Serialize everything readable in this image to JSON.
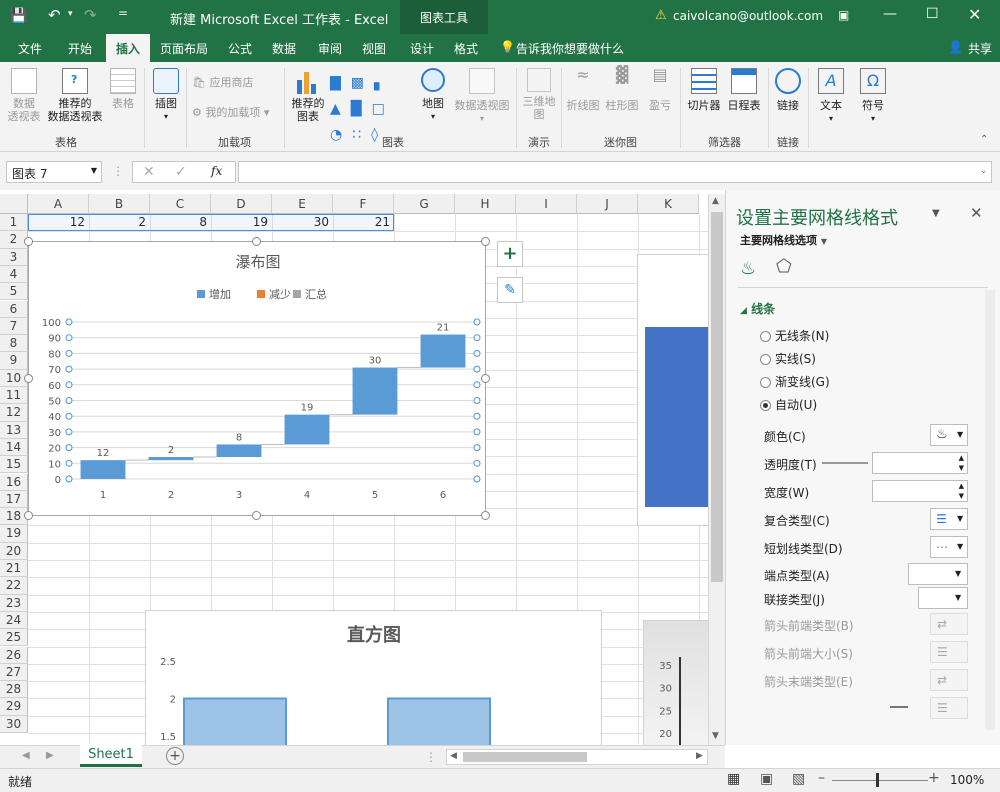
{
  "window": {
    "title": "新建 Microsoft Excel 工作表 - Excel",
    "context_tool": "图表工具",
    "account": "caivolcano@outlook.com",
    "share": "共享",
    "tell_me": "告诉我你想要做什么"
  },
  "tabs": [
    "文件",
    "开始",
    "插入",
    "页面布局",
    "公式",
    "数据",
    "审阅",
    "视图",
    "设计",
    "格式"
  ],
  "ribbon": {
    "buttons": {
      "pivot": "数据\n透视表",
      "rec_pivot": "推荐的\n数据透视表",
      "table": "表格",
      "illustrations": "插图",
      "store": "应用商店",
      "my_addins": "我的加载项",
      "rec_charts": "推荐的\n图表",
      "map": "地图",
      "pivot_chart": "数据透视图",
      "map3d": "三维地\n图",
      "line": "折线图",
      "column": "柱形图",
      "winloss": "盈亏",
      "slicer": "切片器",
      "timeline": "日程表",
      "link": "链接",
      "text": "文本",
      "symbol": "符号"
    },
    "groups": [
      "表格",
      "加载项",
      "图表",
      "演示",
      "迷你图",
      "筛选器",
      "链接"
    ]
  },
  "formula_bar": {
    "name_box": "图表 7",
    "fx": "fx",
    "content": ""
  },
  "sheet": {
    "columns": [
      "A",
      "B",
      "C",
      "D",
      "E",
      "F",
      "G",
      "H",
      "I",
      "J",
      "K"
    ],
    "rows": [
      "1",
      "2",
      "3",
      "4",
      "5",
      "6",
      "7",
      "8",
      "9",
      "10",
      "11",
      "12",
      "13",
      "14",
      "15",
      "16",
      "17",
      "18",
      "19",
      "20",
      "21",
      "22",
      "23",
      "24",
      "25",
      "26",
      "27",
      "28",
      "29",
      "30"
    ],
    "row1_values": [
      "12",
      "2",
      "8",
      "19",
      "30",
      "21"
    ],
    "tab": "Sheet1"
  },
  "chart_data": [
    {
      "type": "bar",
      "subtype": "waterfall",
      "title": "瀑布图",
      "legend": [
        "增加",
        "减少",
        "汇总"
      ],
      "legend_colors": [
        "#5b9bd5",
        "#ed7d31",
        "#a5a5a5"
      ],
      "legend_position": "top",
      "categories": [
        "1",
        "2",
        "3",
        "4",
        "5",
        "6"
      ],
      "values": [
        12,
        2,
        8,
        19,
        30,
        21
      ],
      "ylim": [
        0,
        100
      ],
      "yticks": [
        "0",
        "10",
        "20",
        "30",
        "40",
        "50",
        "60",
        "70",
        "80",
        "90",
        "100"
      ],
      "grid": true,
      "color": "#5b9bd5"
    },
    {
      "type": "bar",
      "subtype": "histogram",
      "title": "直方图",
      "yticks": [
        "1.5",
        "2",
        "2.5"
      ],
      "values": [
        2,
        2
      ],
      "grid": false,
      "color": "#9dc3e6"
    },
    {
      "type": "bar",
      "partially_visible": true,
      "yticks": [
        "20",
        "25",
        "30",
        "35"
      ]
    }
  ],
  "panel": {
    "title": "设置主要网格线格式",
    "subtitle": "主要网格线选项",
    "section": "线条",
    "radios": [
      {
        "label": "无线条(N)",
        "checked": false
      },
      {
        "label": "实线(S)",
        "checked": false
      },
      {
        "label": "渐变线(G)",
        "checked": false
      },
      {
        "label": "自动(U)",
        "checked": true
      }
    ],
    "props": [
      {
        "label": "颜色(C)",
        "enabled": true
      },
      {
        "label": "透明度(T)",
        "enabled": true
      },
      {
        "label": "宽度(W)",
        "enabled": true
      },
      {
        "label": "复合类型(C)",
        "enabled": true
      },
      {
        "label": "短划线类型(D)",
        "enabled": true
      },
      {
        "label": "端点类型(A)",
        "enabled": true
      },
      {
        "label": "联接类型(J)",
        "enabled": true
      },
      {
        "label": "箭头前端类型(B)",
        "enabled": false
      },
      {
        "label": "箭头前端大小(S)",
        "enabled": false
      },
      {
        "label": "箭头末端类型(E)",
        "enabled": false
      }
    ]
  },
  "status": {
    "ready": "就绪",
    "zoom": "100%"
  }
}
